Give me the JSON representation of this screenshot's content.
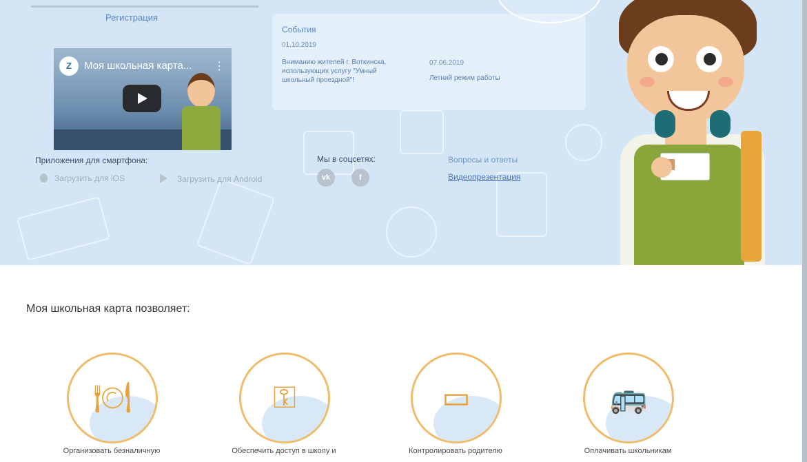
{
  "header": {
    "registration_link": "Регистрация"
  },
  "video": {
    "title": "Моя школьная карта...",
    "logo_text": "Z"
  },
  "events": {
    "heading": "События",
    "items": [
      {
        "date": "01.10.2019",
        "text": "Вниманию жителей г. Воткинска, использующих услугу \"Умный школьный проездной\"!"
      },
      {
        "date": "07.06.2019",
        "text": "Летний режим работы"
      }
    ]
  },
  "apps": {
    "title": "Приложения для смартфона:",
    "ios_label": "Загрузить для iOS",
    "android_label": "Загрузить для Android"
  },
  "social": {
    "title": "Мы в соцсетях:",
    "vk_icon": "vk-icon",
    "fb_icon": "facebook-icon"
  },
  "links": {
    "qa": "Вопросы и ответы",
    "video_presentation": "Видеопрезентация"
  },
  "features": {
    "title": "Моя школьная карта позволяет:",
    "items": [
      {
        "icon": "plate-cutlery-icon",
        "label": "Организовать безналичную"
      },
      {
        "icon": "turnstile-icon",
        "label": "Обеспечить доступ в школу и"
      },
      {
        "icon": "wallet-icon",
        "label": "Контролировать родителю"
      },
      {
        "icon": "transport-icon",
        "label": "Оплачивать школьникам"
      }
    ]
  },
  "colors": {
    "hero_background": "#d4e6f6",
    "accent_orange": "#eebc6a",
    "link_blue": "#5a86c8"
  }
}
